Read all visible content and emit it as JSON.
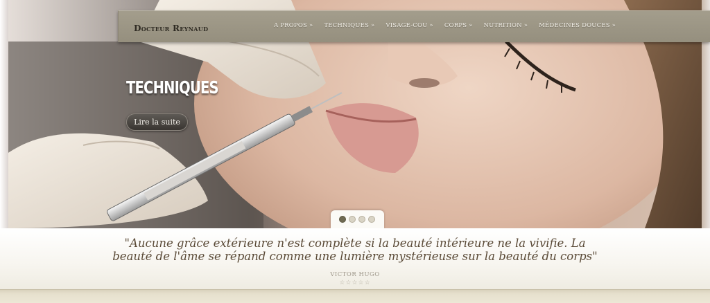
{
  "site": {
    "logo": "Docteur Reynaud"
  },
  "nav": {
    "items": [
      "A PROPOS »",
      "TECHNIQUES »",
      "VISAGE-COU »",
      "CORPS »",
      "NUTRITION »",
      "MÉDECINES DOUCES »"
    ]
  },
  "slide": {
    "title": "TECHNIQUES",
    "button_label": "Lire la suite",
    "dots_count": 4,
    "active_dot": 1
  },
  "quote": {
    "line1": "\"Aucune grâce extérieure n'est complète si la beauté intérieure ne la vivifie. La",
    "line2": "beauté de l'âme se répand comme une lumière mystérieuse sur la beauté du corps\"",
    "author": "VICTOR HUGO",
    "stars": "☆☆☆☆☆"
  },
  "colors": {
    "navbar": "#9b9584",
    "quote_text": "#5a4a37",
    "active_dot": "#6f6a52"
  }
}
